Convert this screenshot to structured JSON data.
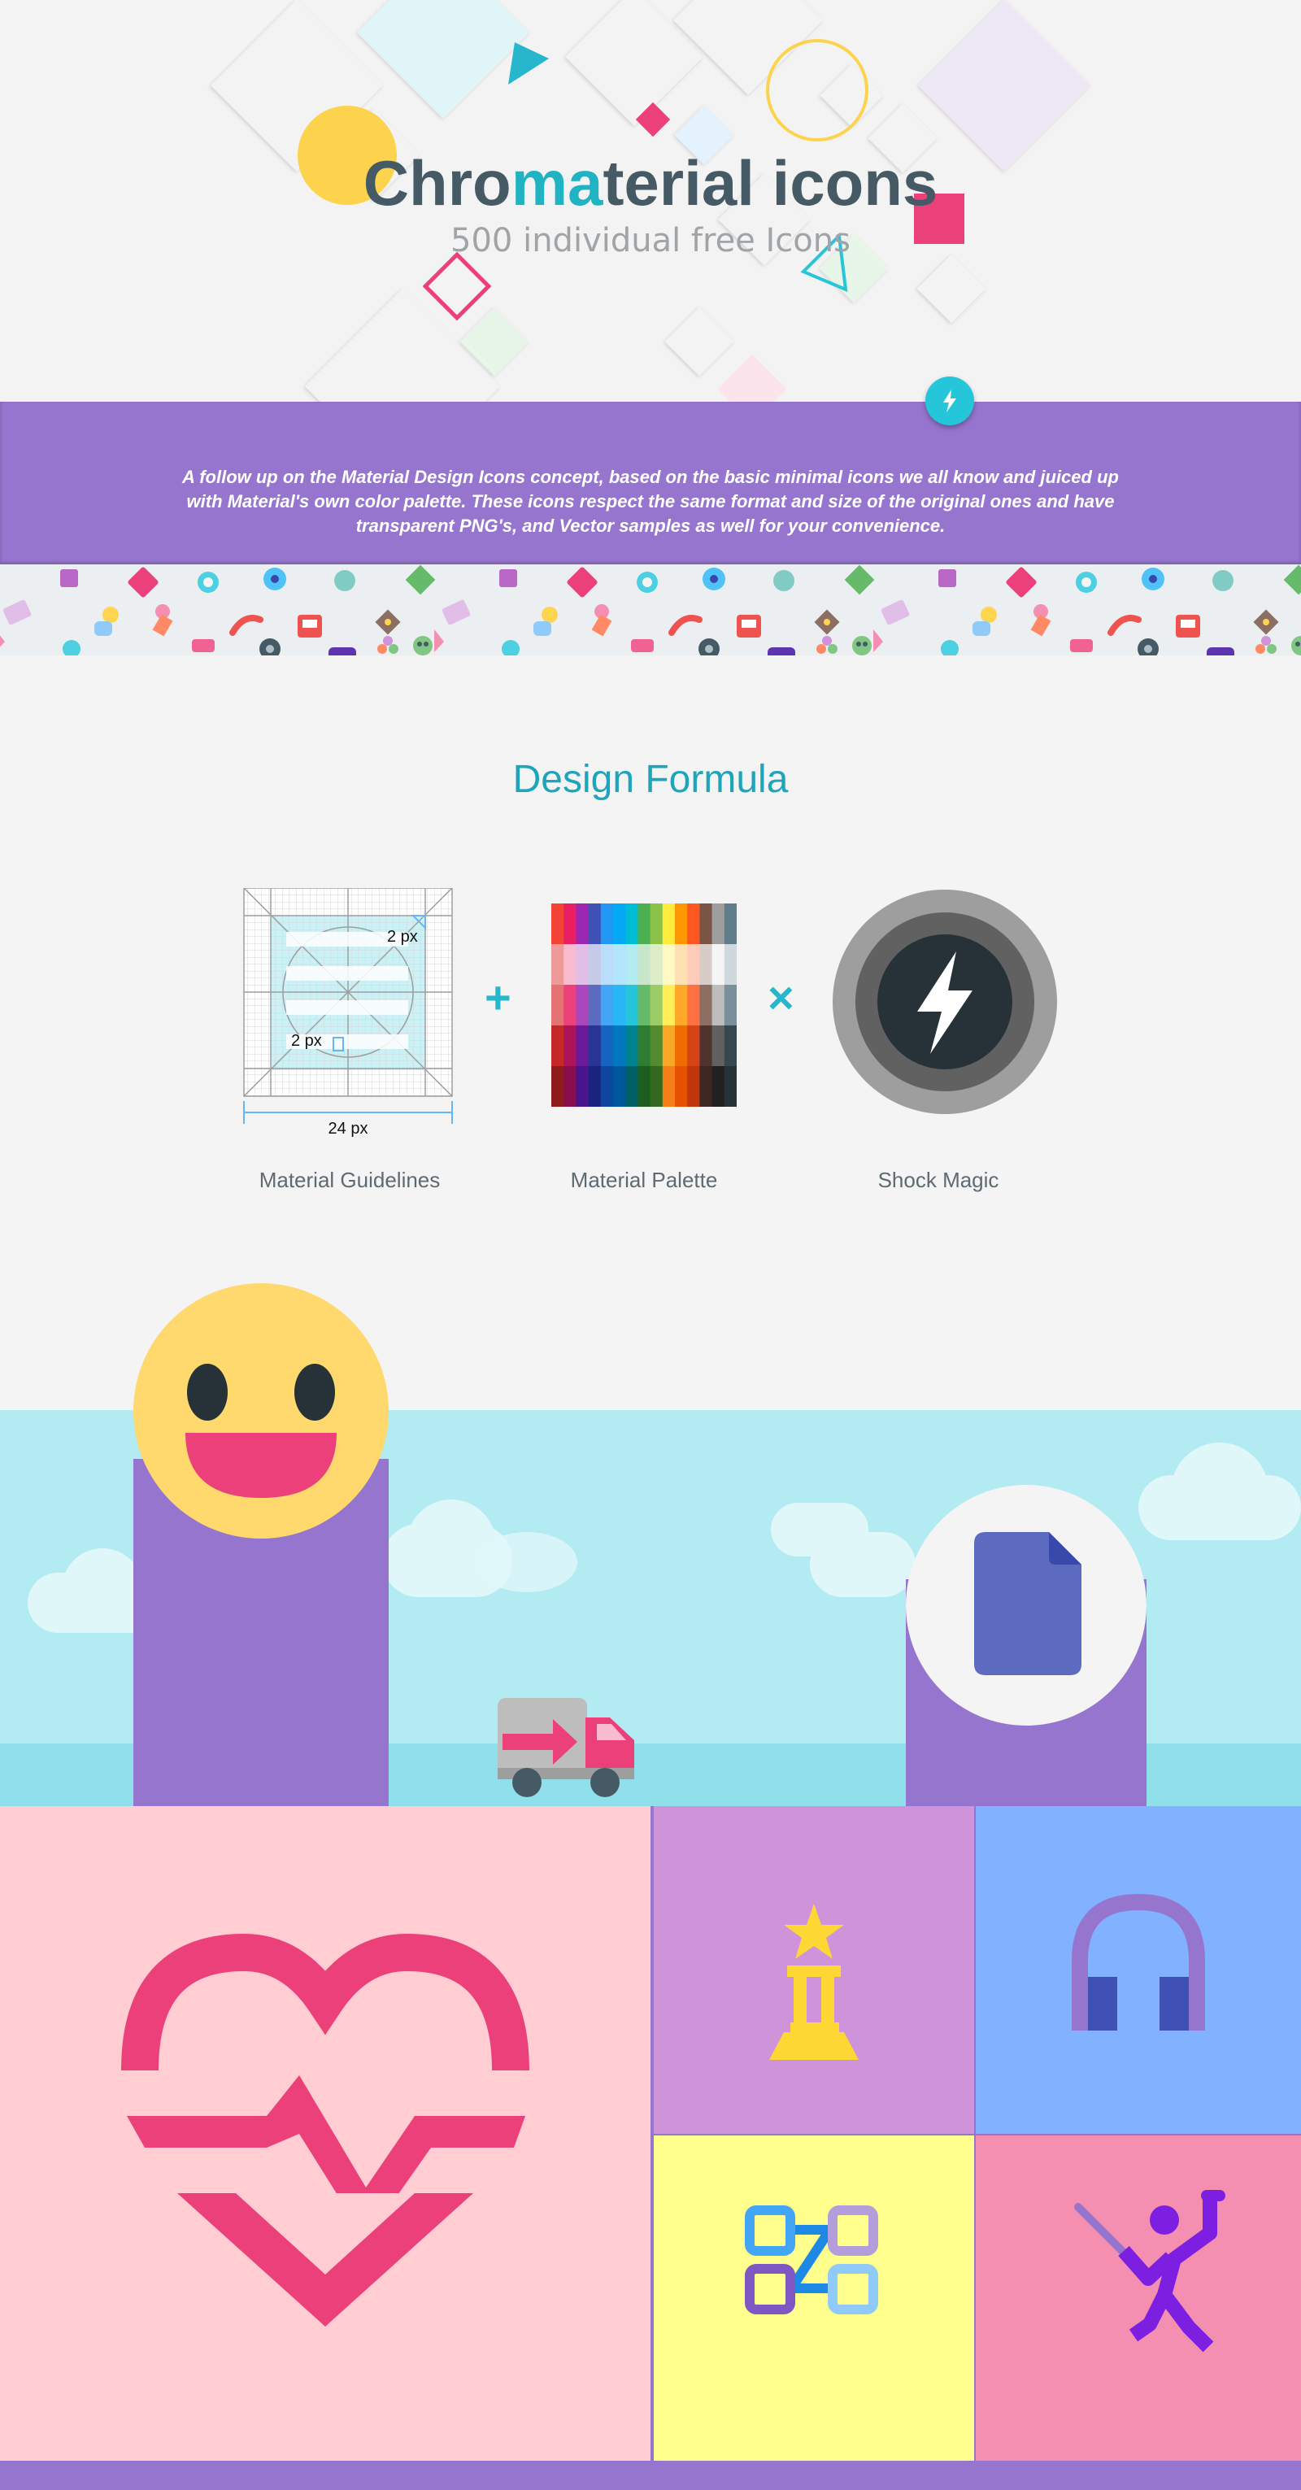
{
  "hero": {
    "title_part1": "Chro",
    "title_accent": "ma",
    "title_part2": "terial icons",
    "subtitle": "500 individual free Icons"
  },
  "band": {
    "description": "A follow up on the Material Design Icons concept, based on the basic minimal icons we all know and juiced up with Material's own color palette. These icons respect the same format and size of the original ones and have transparent PNG's, and Vector samples as well for your convenience.",
    "fab_icon": "bolt-icon"
  },
  "formula": {
    "title": "Design Formula",
    "guidelines": {
      "caption": "Material Guidelines",
      "dim_top": "2 px",
      "dim_left": "2 px",
      "dim_bottom": "24 px"
    },
    "palette": {
      "caption": "Material Palette"
    },
    "magic": {
      "caption": "Shock Magic"
    },
    "plus_sign": "+",
    "times_sign": "×"
  },
  "colors": {
    "accent": "#1fb3c4",
    "purple": "#9575cd",
    "pink": "#ec407a",
    "sky": "#b2ebf2"
  },
  "grid_icons": [
    "heart-pulse-icon",
    "monument-icon",
    "headphones-icon",
    "workflow-icon",
    "fencing-icon"
  ]
}
